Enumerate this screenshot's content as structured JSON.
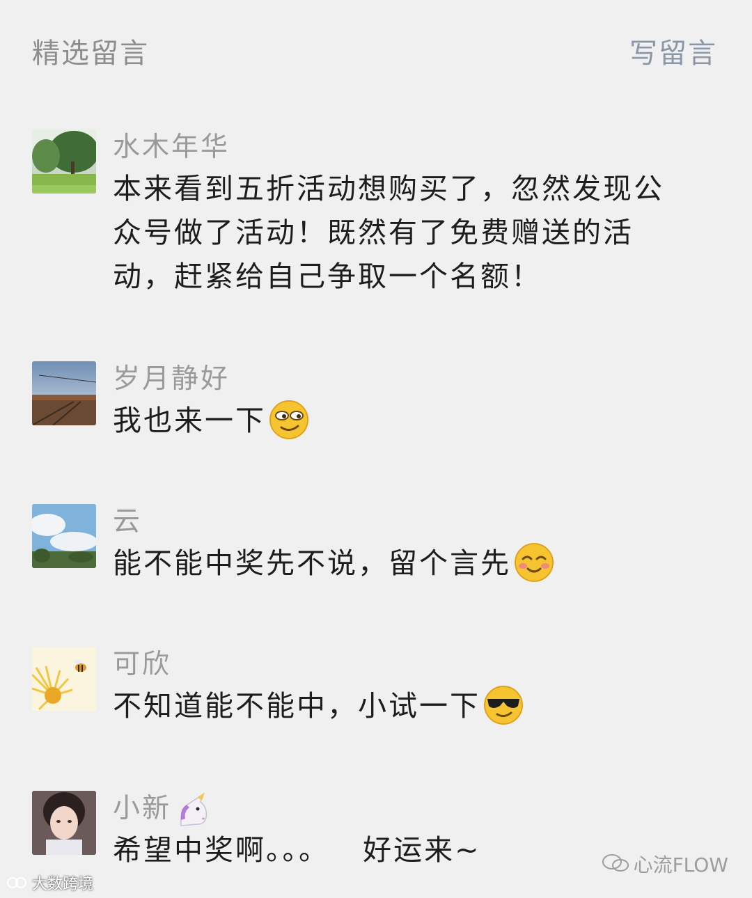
{
  "header": {
    "title": "精选留言",
    "write_label": "写留言"
  },
  "comments": [
    {
      "nickname": "水木年华",
      "text": "本来看到五折活动想购买了，忽然发现公众号做了活动！既然有了免费赠送的活动，赶紧给自己争取一个名额！",
      "avatar_icon": "park-tree-avatar"
    },
    {
      "nickname": "岁月静好",
      "text": "我也来一下",
      "emoji": "smirk-face",
      "avatar_icon": "railway-sunset-avatar"
    },
    {
      "nickname": "云",
      "text": "能不能中奖先不说，留个言先",
      "emoji": "blushing-smile-face",
      "avatar_icon": "sky-clouds-avatar"
    },
    {
      "nickname": "可欣",
      "text": "不知道能不能中，小试一下",
      "emoji": "sunglasses-face",
      "avatar_icon": "bee-flower-avatar"
    },
    {
      "nickname": "小新",
      "nickname_emoji": "unicorn",
      "text": "希望中奖啊。。。   好运来~",
      "avatar_icon": "girl-portrait-avatar"
    }
  ],
  "watermarks": {
    "left": "大数跨境",
    "right": "心流FLOW"
  }
}
